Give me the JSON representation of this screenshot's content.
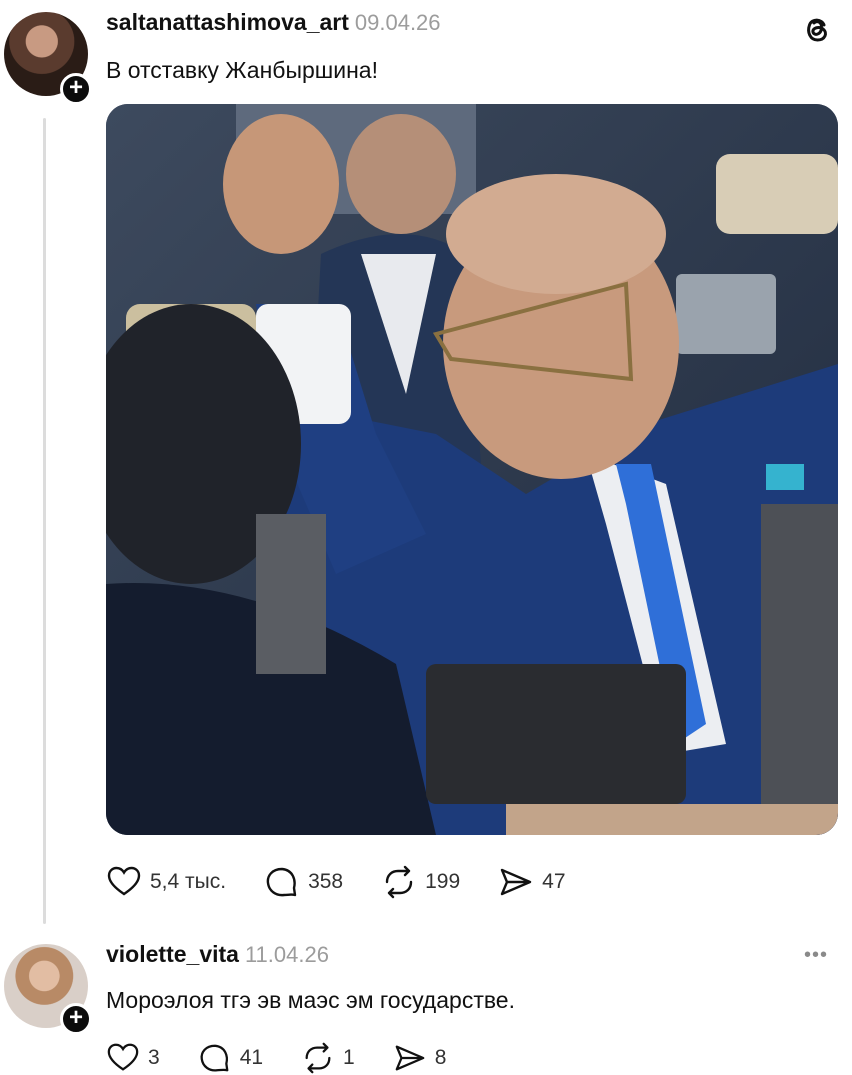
{
  "post": {
    "username": "saltanattashimova_art",
    "date": "09.04.26",
    "text": "В отставку Жанбыршина!",
    "actions": {
      "likes": "5,4 тыс.",
      "comments": "358",
      "reposts": "199",
      "shares": "47"
    },
    "icons": [
      "threads-logo",
      "heart-icon",
      "comment-icon",
      "repost-icon",
      "share-icon",
      "plus-icon"
    ]
  },
  "reply": {
    "username": "violette_vita",
    "date": "11.04.26",
    "text": "Мороэлоя тгэ   эв маэс эм государстве.",
    "more": "•••",
    "actions": {
      "likes": "3",
      "comments": "41",
      "reposts": "1",
      "shares": "8"
    }
  },
  "colors": {
    "background": "#ffffff",
    "text": "#111111",
    "muted": "#9c9c9c",
    "badge": "#0c0c0c"
  }
}
